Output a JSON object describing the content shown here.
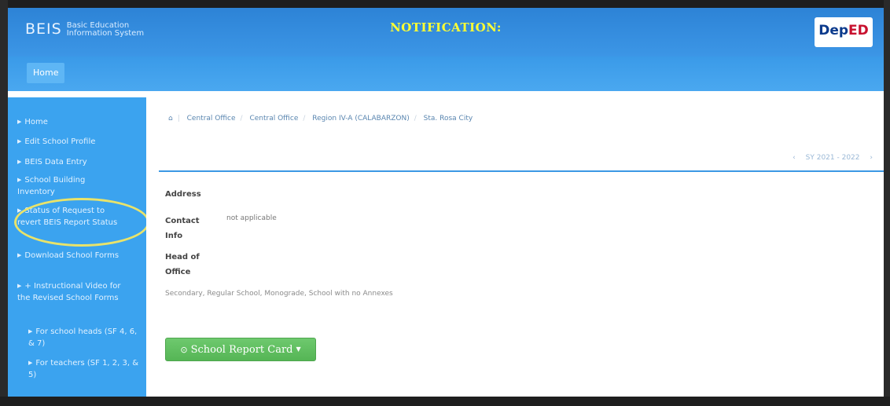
{
  "header": {
    "logo_main": "BEIS",
    "logo_sub_line1": "Basic Education",
    "logo_sub_line2": "Information System",
    "notification": "NOTIFICATION:",
    "deped_logo_text": "DepED"
  },
  "nav": {
    "home_label": "Home"
  },
  "sidebar": {
    "items": [
      {
        "label": "Home"
      },
      {
        "label": "Edit School Profile"
      },
      {
        "label": "BEIS Data Entry"
      },
      {
        "label": "School Building Inventory"
      },
      {
        "label": "Status of Request to revert BEIS Report Status"
      },
      {
        "label": "Download School Forms"
      },
      {
        "label": "+ Instructional Video for the Revised School Forms"
      },
      {
        "label": "For school heads (SF 4, 6, & 7)"
      },
      {
        "label": "For teachers (SF 1, 2, 3, & 5)"
      }
    ]
  },
  "breadcrumb": {
    "home_icon": "home-icon",
    "items": [
      "Central Office",
      "Central Office",
      "Region IV-A (CALABARZON)",
      "Sta. Rosa City"
    ]
  },
  "school_year": {
    "prev": "‹",
    "label": "SY 2021 - 2022",
    "next": "›"
  },
  "profile": {
    "address_label": "Address",
    "contact_label_line1": "Contact",
    "contact_label_line2": "Info",
    "contact_value": "not applicable",
    "head_label_line1": "Head of",
    "head_label_line2": "Office",
    "description": "Secondary, Regular School, Monograde, School with no Annexes"
  },
  "report_button": {
    "icon": "globe-icon",
    "label": "School Report Card"
  },
  "colors": {
    "header_blue": "#2d83d6",
    "sidebar_blue": "#3ba3ef",
    "notification_yellow": "#ffff33",
    "button_green": "#5cb85c",
    "highlight_ring": "#e9e36a"
  }
}
